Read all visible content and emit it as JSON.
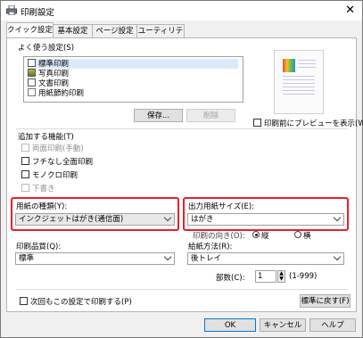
{
  "window": {
    "title": "印刷設定",
    "close_glyph": "✕"
  },
  "tabs": [
    {
      "label": "クイック設定",
      "active": true
    },
    {
      "label": "基本設定",
      "active": false
    },
    {
      "label": "ページ設定",
      "active": false
    },
    {
      "label": "ユーティリティ",
      "active": false
    }
  ],
  "favorites": {
    "label": "よく使う設定(S)",
    "items": [
      {
        "label": "標準印刷",
        "icon": "document-icon",
        "selected": true
      },
      {
        "label": "写真印刷",
        "icon": "photo-icon",
        "selected": false
      },
      {
        "label": "文書印刷",
        "icon": "document-icon",
        "selected": false
      },
      {
        "label": "用紙節約印刷",
        "icon": "paper-saving-icon",
        "selected": false
      }
    ],
    "save_label": "保存...",
    "delete_label": "削除"
  },
  "preview": {
    "checkbox_label": "印刷前にプレビューを表示(W)",
    "checked": false
  },
  "additional": {
    "label": "追加する機能(T)",
    "items": [
      {
        "label": "両面印刷(手動)",
        "enabled": false,
        "checked": false
      },
      {
        "label": "フチなし全面印刷",
        "enabled": true,
        "checked": false
      },
      {
        "label": "モノクロ印刷",
        "enabled": true,
        "checked": false
      },
      {
        "label": "下書き",
        "enabled": false,
        "checked": false
      }
    ]
  },
  "media_type": {
    "label": "用紙の種類(Y):",
    "value": "インクジェットはがき(通信面)"
  },
  "output_size": {
    "label": "出力用紙サイズ(E):",
    "value": "はがき"
  },
  "orientation": {
    "label": "印刷の向き(O):",
    "options": [
      "縦",
      "横"
    ],
    "selected": "縦"
  },
  "print_quality": {
    "label": "印刷品質(Q):",
    "value": "標準"
  },
  "paper_source": {
    "label": "給紙方法(R):",
    "value": "後トレイ"
  },
  "copies": {
    "label": "部数(C):",
    "value": "1",
    "range": "(1-999)"
  },
  "footer": {
    "always_print_label": "次回もこの設定で印刷する(P)",
    "reset_label": "標準に戻す(F)",
    "ok_label": "OK",
    "cancel_label": "キャンセル",
    "help_label": "ヘルプ"
  }
}
